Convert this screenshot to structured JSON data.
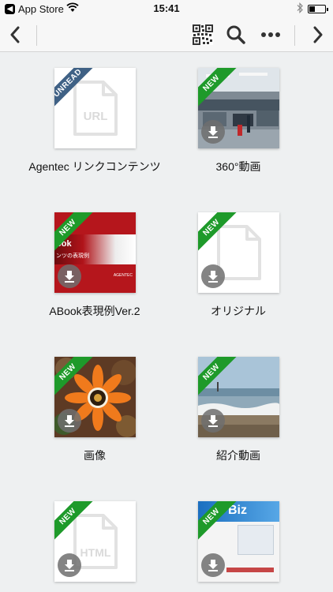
{
  "status_bar": {
    "back_app_label": "App Store",
    "time": "15:41"
  },
  "nav_bar": {
    "back_icon": "chevron-left-icon",
    "actions": [
      "qr-code-icon",
      "search-icon",
      "more-icon"
    ],
    "forward_icon": "chevron-right-icon"
  },
  "colors": {
    "new_ribbon": "#1e9a2a",
    "unread_ribbon": "#3f6185",
    "background": "#eef0f1"
  },
  "items": [
    {
      "label": "Agentec リンクコンテンツ",
      "badge": "UNREAD",
      "icon_text": "URL",
      "thumb": "file-icon",
      "downloadable": false
    },
    {
      "label": "360°動画",
      "badge": "NEW",
      "thumb": "office-photo",
      "downloadable": true
    },
    {
      "label": "ABook表現例Ver.2",
      "badge": "NEW",
      "thumb_title": "ook",
      "thumb_subtitle": "ンツの表現例",
      "thumb_corner": "AGENTEC",
      "downloadable": true
    },
    {
      "label": "オリジナル",
      "badge": "NEW",
      "icon_text": "",
      "thumb": "file-icon",
      "downloadable": true
    },
    {
      "label": "画像",
      "badge": "NEW",
      "thumb": "flower-photo",
      "downloadable": true
    },
    {
      "label": "紹介動画",
      "badge": "NEW",
      "thumb": "beach-photo",
      "downloadable": true
    },
    {
      "label": "",
      "badge": "NEW",
      "icon_text": "HTML",
      "thumb": "file-icon",
      "downloadable": true
    },
    {
      "label": "",
      "badge": "NEW",
      "thumb_title": "Biz",
      "thumb": "brochure",
      "downloadable": true
    }
  ]
}
